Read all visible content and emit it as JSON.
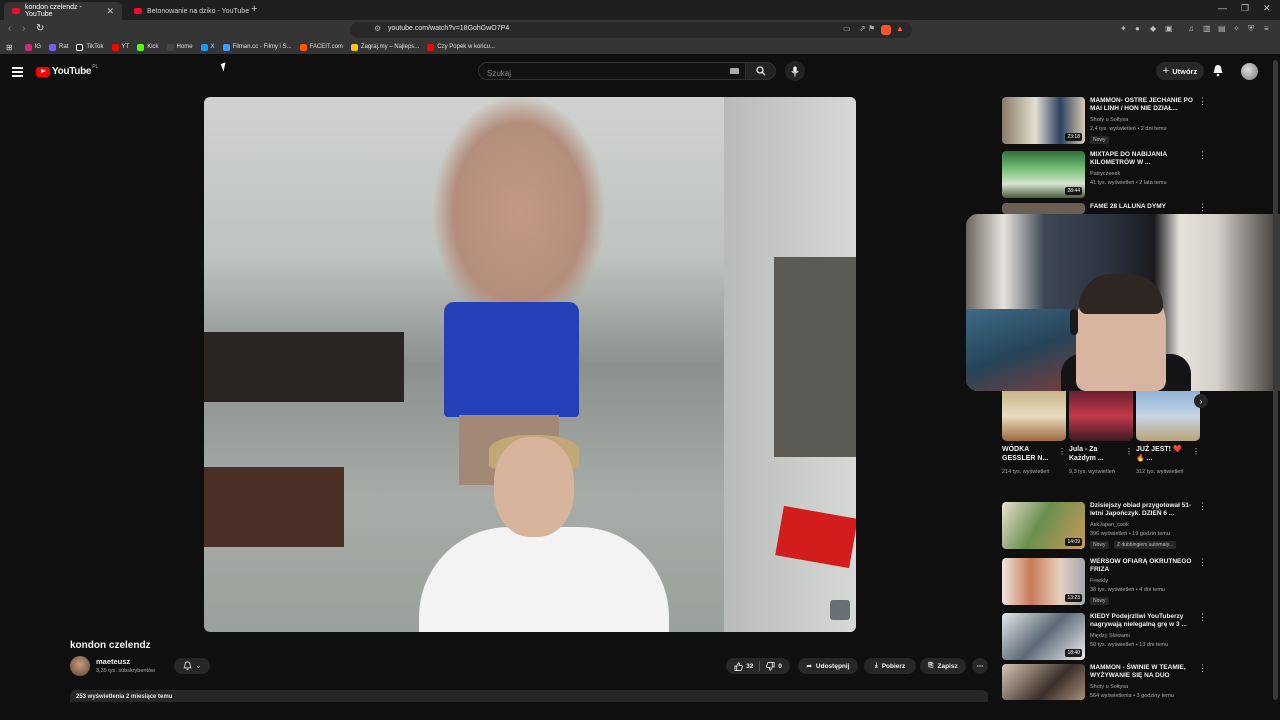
{
  "browser": {
    "tabs": [
      {
        "title": "kondon czelendz - YouTube",
        "active": true
      },
      {
        "title": "Betonowanie na dziko - YouTube",
        "active": false
      }
    ],
    "url": "youtube.com/watch?v=18GohGwO7P4",
    "bookmarks": [
      {
        "label": "IG",
        "color": "#d62976"
      },
      {
        "label": "Rat",
        "color": "#7b5cff"
      },
      {
        "label": "TikTok",
        "color": "#ffffff"
      },
      {
        "label": "YT",
        "color": "#ff0000"
      },
      {
        "label": "Kick",
        "color": "#53fc18"
      },
      {
        "label": "Home",
        "color": "#ffffff"
      },
      {
        "label": "X",
        "color": "#1d9bf0"
      },
      {
        "label": "Filman.cc - Filmy i S...",
        "color": "#3aa0ff"
      },
      {
        "label": "FACEIT.com",
        "color": "#ff5500"
      },
      {
        "label": "Zagraj.my – Najleps...",
        "color": "#f5c518"
      },
      {
        "label": "Czy Popek w końcu...",
        "color": "#ff0000"
      }
    ]
  },
  "youtube": {
    "logo_text": "YouTube",
    "logo_country": "PL",
    "search_placeholder": "Szukaj",
    "create_label": "Utwórz",
    "accent": "#ff0000"
  },
  "video": {
    "title": "kondon czelendz",
    "channel": "maeteusz",
    "subscribers": "3,35 tys. subskrybentów",
    "likes": "32",
    "dislikes": "0",
    "share_label": "Udostępnij",
    "download_label": "Pobierz",
    "save_label": "Zapisz",
    "description_preview": "253 wyświetlenia  2 miesiące temu"
  },
  "sidebar": {
    "recommendations_top": [
      {
        "title": "MAMMON- OSTRE JECHANIE PO MAI LINH / HON NIE DZIAŁ...",
        "channel": "Shoty u Sołtysa",
        "meta": "2,4 tys. wyświetleń • 2 dni temu",
        "badge": "Nowy",
        "duration": "23:18"
      },
      {
        "title": "MIXTAPE DO NABIJANIA KILOMETRÓW W ...",
        "channel": "Patryczeeek",
        "meta": "41 tys. wyświetleń • 2 lata temu",
        "badge": "",
        "duration": "28:44"
      },
      {
        "title": "FAME 28  LALUNA  DYMY",
        "channel": "",
        "meta": "",
        "badge": "",
        "duration": ""
      }
    ],
    "shorts": [
      {
        "title": "WÓDKA GESSLER N...",
        "views": "214 tys. wyświetleń"
      },
      {
        "title": "Jula - Za Każdym ...",
        "views": "9,3 tys. wyświetleń"
      },
      {
        "title": "JUŻ JEST! ❤️🔥 ...",
        "views": "312 tys. wyświetleń"
      }
    ],
    "recommendations_bottom": [
      {
        "title": "Dzisiejszy obiad przygotował 51-letni Japończyk. DZIEŃ 6 ...",
        "channel": "AskJapan_cook",
        "meta": "396 wyświetleń • 19 godzin temu",
        "badge": "Nowy",
        "badge2": "Z dubbingiem automaty...",
        "duration": "14:09"
      },
      {
        "title": "WERSOW OFIARĄ OKRUTNEGO FRIZA",
        "channel": "Freekly",
        "meta": "38 tys. wyświetleń • 4 dni temu",
        "badge": "Nowy",
        "badge2": "",
        "duration": "13:23"
      },
      {
        "title": "KIEDY Podejrzliwi YouTuberzy nagrywają nielegalną grę w 3 ...",
        "channel": "Między Słowami",
        "meta": "50 tys. wyświetleń • 13 dni temu",
        "badge": "",
        "badge2": "",
        "duration": "18:40"
      },
      {
        "title": "MAMMON - ŚWINIE W TEAMIE, WYŻYWANIE SIĘ NA DUO",
        "channel": "Shoty u Sołtysa",
        "meta": "564 wyświetlenia • 3 godziny temu",
        "badge": "",
        "badge2": "",
        "duration": ""
      }
    ]
  }
}
